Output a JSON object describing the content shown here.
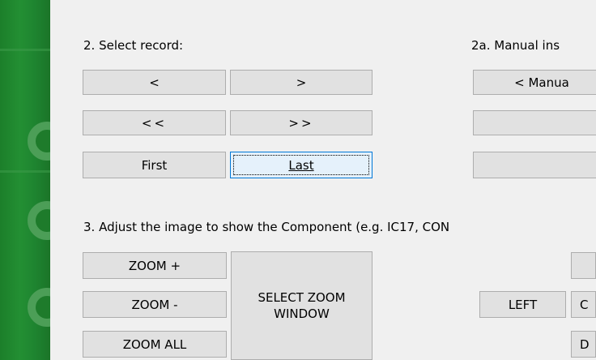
{
  "section2": {
    "title": "2. Select record:",
    "buttons": {
      "prev": "<",
      "next": ">",
      "prev_fast": "<<",
      "next_fast": ">>",
      "first": "First",
      "last": "Last"
    }
  },
  "section2a": {
    "title": "2a. Manual ins",
    "manual_button": "< Manua",
    "blank_button_1": "",
    "blank_button_2": ""
  },
  "section3": {
    "title": "3. Adjust the image to show the Component (e.g. IC17, CON",
    "buttons": {
      "zoom_in": "ZOOM +",
      "zoom_out": "ZOOM -",
      "zoom_all": "ZOOM ALL",
      "select_zoom_window": "SELECT ZOOM WINDOW",
      "left": "LEFT",
      "center_partial": "C",
      "down_partial": "D",
      "up_partial": ""
    }
  }
}
